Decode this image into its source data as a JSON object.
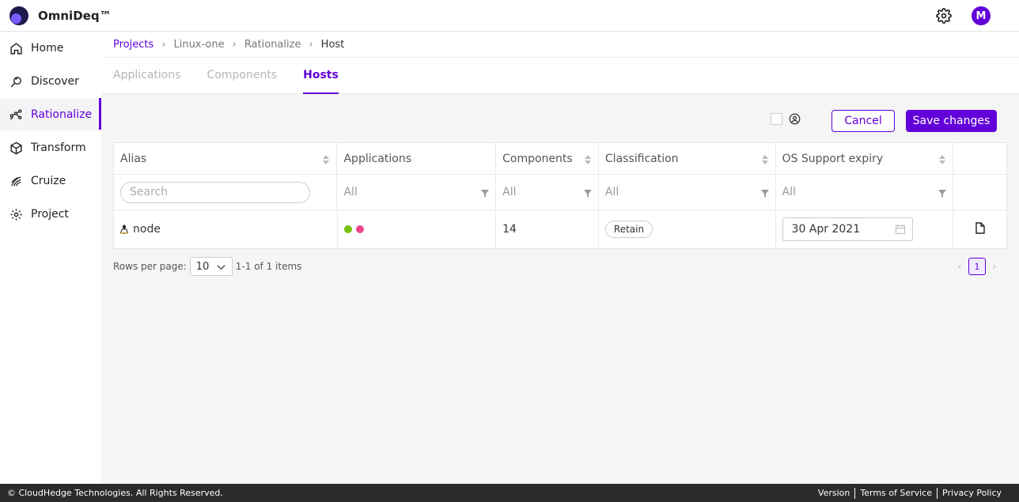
{
  "header": {
    "brand": "OmniDeq™",
    "avatar_initial": "M"
  },
  "sidebar": {
    "items": [
      {
        "label": "Home",
        "icon": "home-icon"
      },
      {
        "label": "Discover",
        "icon": "discover-icon"
      },
      {
        "label": "Rationalize",
        "icon": "rationalize-icon",
        "active": true
      },
      {
        "label": "Transform",
        "icon": "cube-icon"
      },
      {
        "label": "Cruize",
        "icon": "cruize-icon"
      },
      {
        "label": "Project",
        "icon": "gear-icon"
      }
    ]
  },
  "breadcrumb": [
    "Projects",
    "Linux-one",
    "Rationalize",
    "Host"
  ],
  "tabs": [
    {
      "label": "Applications",
      "active": false
    },
    {
      "label": "Components",
      "active": false
    },
    {
      "label": "Hosts",
      "active": true
    }
  ],
  "toolbar": {
    "cancel_label": "Cancel",
    "save_label": "Save changes"
  },
  "table": {
    "columns": [
      "Alias",
      "Applications",
      "Components",
      "Classification",
      "OS Support expiry"
    ],
    "filters": {
      "search_placeholder": "Search",
      "applications": "All",
      "components": "All",
      "classification": "All",
      "os_support": "All"
    },
    "rows": [
      {
        "alias": "node",
        "app_dot_colors": [
          "#76c00a",
          "#f0478c"
        ],
        "components": "14",
        "classification": "Retain",
        "os_support_expiry": "30 Apr 2021"
      }
    ]
  },
  "pagination": {
    "rows_per_page_label": "Rows per page:",
    "rows_per_page": "10",
    "range": "1-1 of 1 items",
    "current_page": "1"
  },
  "footer": {
    "copyright": "© CloudHedge Technologies. All Rights Reserved.",
    "links": [
      "Version",
      "Terms of Service",
      "Privacy Policy"
    ]
  },
  "colors": {
    "accent": "#6200d9"
  }
}
